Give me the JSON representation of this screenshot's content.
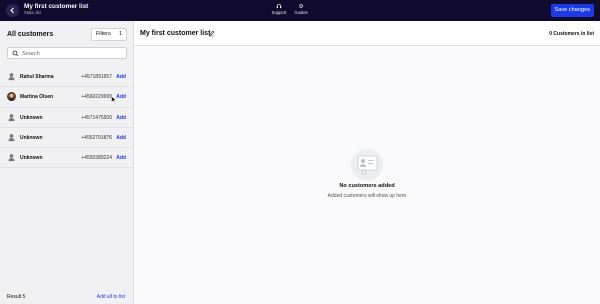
{
  "header": {
    "title": "My first customer list",
    "subtitle": "Static list",
    "support_label": "Support",
    "guides_label": "Guides",
    "save_label": "Save changes"
  },
  "sidebar": {
    "heading": "All customers",
    "filters_label": "Filters",
    "filters_count": "1",
    "search_placeholder": "Search",
    "customers": [
      {
        "name": "Rahul Sharma",
        "phone": "+4571891657",
        "action": "Add",
        "avatar": "person-icon"
      },
      {
        "name": "Martina Olsen",
        "phone": "+4560229699",
        "action": "Add",
        "avatar": "photo-avatar"
      },
      {
        "name": "Unknown",
        "phone": "+4571475500",
        "action": "Add",
        "avatar": "person-icon"
      },
      {
        "name": "Unknown",
        "phone": "+4552791876",
        "action": "Add",
        "avatar": "person-icon"
      },
      {
        "name": "Unknown",
        "phone": "+4550389224",
        "action": "Add",
        "avatar": "person-icon"
      }
    ],
    "result_label": "Result 5",
    "add_all_label": "Add all to list"
  },
  "main": {
    "list_title": "My first customer list",
    "count_label": "0 Customers in list",
    "empty_title": "No customers added",
    "empty_subtitle": "Added customers will show up here"
  },
  "colors": {
    "topbar": "#0f0a2e",
    "accent": "#1e3ae6"
  }
}
